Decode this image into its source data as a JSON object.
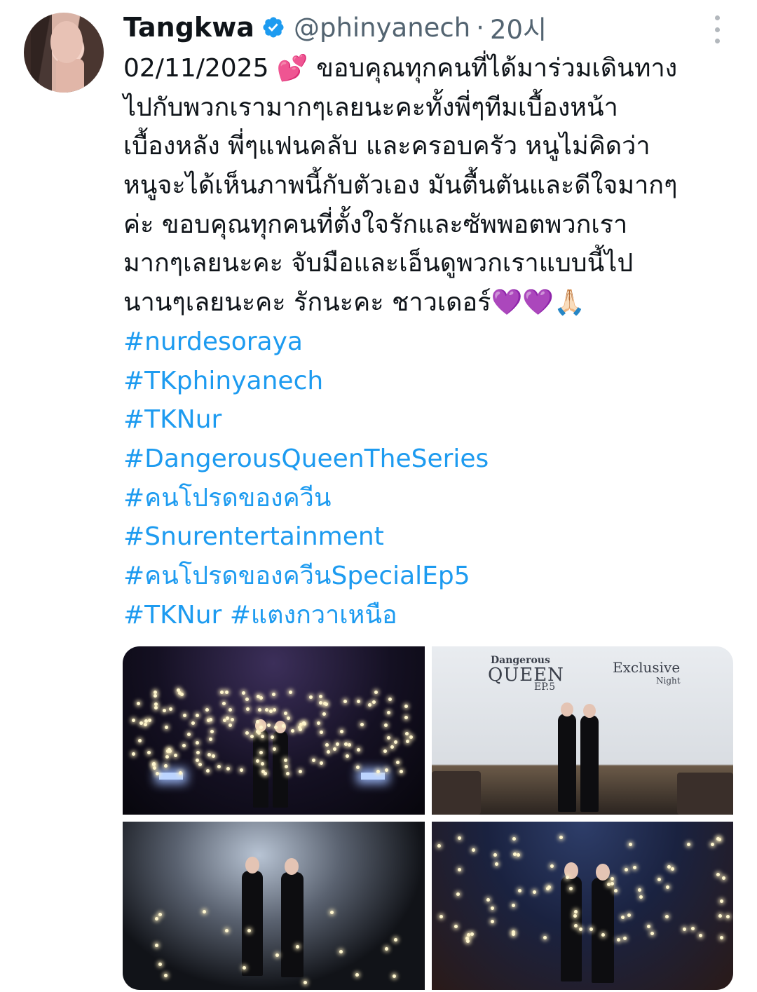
{
  "tweet": {
    "author_name": "Tangkwa",
    "handle": "@phinyanech",
    "separator": "·",
    "time": "20시",
    "verified": true,
    "text_lines": [
      "02/11/2025 💕 ขอบคุณทุกคนที่ได้มาร่วมเดินทาง",
      "ไปกับพวกเรามากๆเลยนะคะทั้งพี่ๆทีมเบื้องหน้า",
      "เบื้องหลัง พี่ๆแฟนคลับ และครอบครัว หนูไม่คิดว่า",
      "หนูจะได้เห็นภาพนี้กับตัวเอง มันตื้นตันและดีใจมากๆ",
      "ค่ะ ขอบคุณทุกคนที่ตั้งใจรักและซัพพอตพวกเรา",
      "มากๆเลยนะคะ จับมือและเอ็นดูพวกเราแบบนี้ไป",
      "นานๆเลยนะคะ รักนะคะ ชาวเดอร์💜💜🙏🏻"
    ],
    "hashtag_lines": [
      "#nurdesoraya",
      "#TKphinyanech",
      "#TKNur",
      "#DangerousQueenTheSeries",
      "#คนโปรดของควีน",
      "#Snurentertainment",
      "#คนโปรดของควีนSpecialEp5",
      "#TKNur #แตงกวาเหนือ"
    ],
    "poster": {
      "title_line1": "Dangerous",
      "title_line2": "QUEEN",
      "episode": "EP.5",
      "exclusive": "Exclusive",
      "night": "Night"
    }
  },
  "icons": [
    "verified-badge-icon",
    "more-options-icon"
  ],
  "colors": {
    "hashtag": "#1d9bf0",
    "secondary_text": "#536471",
    "verified": "#1d9bf0"
  }
}
